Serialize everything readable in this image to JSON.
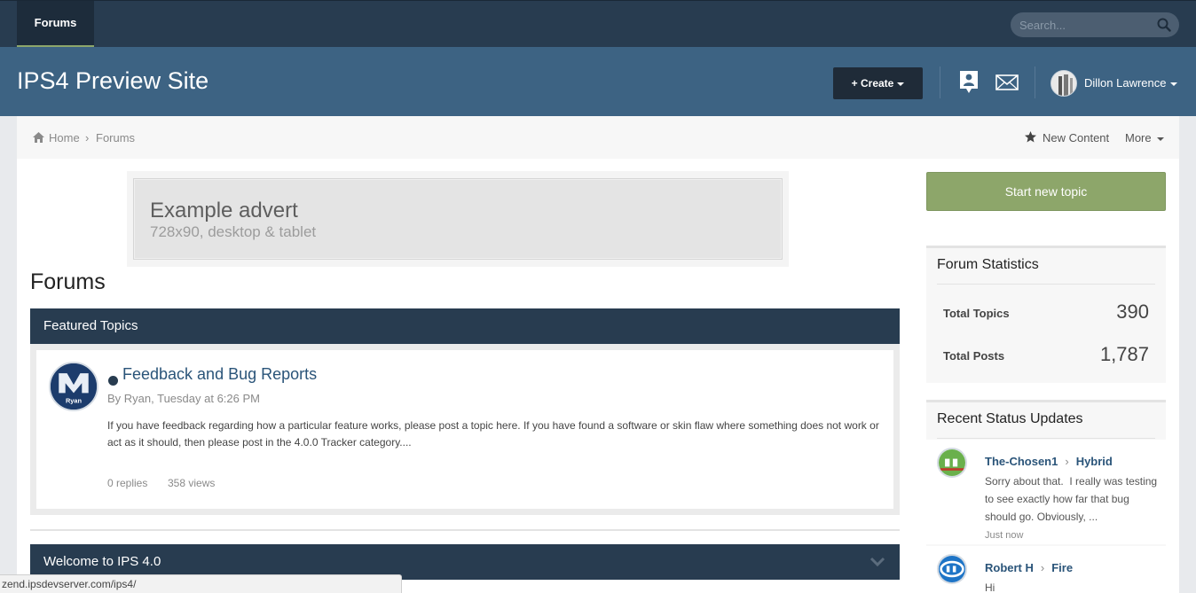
{
  "nav": {
    "tab_label": "Forums",
    "search_placeholder": "Search..."
  },
  "header": {
    "site_title": "IPS4 Preview Site",
    "create_label": "+ Create",
    "user_name": "Dillon Lawrence"
  },
  "breadcrumb": {
    "home": "Home",
    "separator": "›",
    "current": "Forums"
  },
  "toolbar": {
    "new_content": "New Content",
    "more": "More"
  },
  "advert": {
    "title": "Example advert",
    "subtitle": "728x90, desktop & tablet"
  },
  "page": {
    "title": "Forums"
  },
  "featured": {
    "heading": "Featured Topics",
    "topic": {
      "avatar_label": "Ryan",
      "title": "Feedback and Bug Reports",
      "meta": "By Ryan, Tuesday at 6:26 PM",
      "excerpt": "If you have feedback regarding how a particular feature works, please post a topic here. If you have found a software or skin flaw where something does not work or act as it should, then please post in the 4.0.0 Tracker category....",
      "replies": "0 replies",
      "views": "358 views"
    }
  },
  "welcome": {
    "heading": "Welcome to IPS 4.0"
  },
  "sidebar": {
    "start_topic": "Start new topic",
    "stats": {
      "title": "Forum Statistics",
      "rows": [
        {
          "label": "Total Topics",
          "value": "390"
        },
        {
          "label": "Total Posts",
          "value": "1,787"
        }
      ]
    },
    "status": {
      "title": "Recent Status Updates",
      "items": [
        {
          "author": "The-Chosen1",
          "sep": "›",
          "target": "Hybrid",
          "text": "Sorry about that.  I really was testing to see exactly how far that bug should go. Obviously, ...",
          "time": "Just now"
        },
        {
          "author": "Robert H",
          "sep": "›",
          "target": "Fire",
          "text": "Hi",
          "time": ""
        }
      ]
    }
  },
  "statusbar": {
    "url": "zend.ipsdevserver.com/ips4/"
  },
  "colors": {
    "nav_bg": "#283c50",
    "header_bg": "#3d6383",
    "accent_green": "#8da66a",
    "link": "#2a5479"
  }
}
